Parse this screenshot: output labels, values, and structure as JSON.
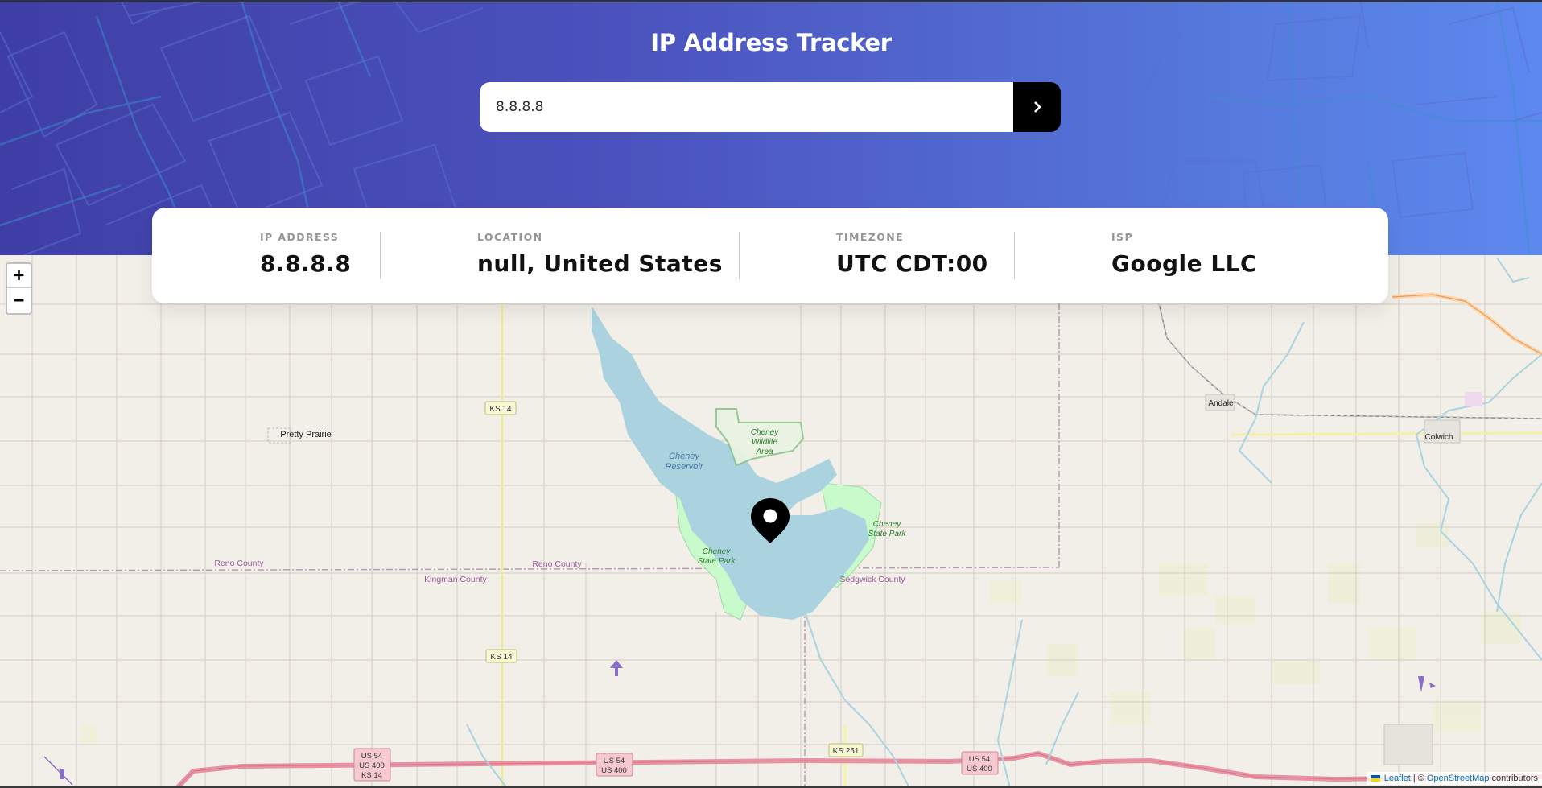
{
  "app": {
    "title": "IP Address Tracker"
  },
  "search": {
    "value": "8.8.8.8",
    "button_icon": "chevron-right-icon"
  },
  "info": {
    "ip": {
      "label": "IP ADDRESS",
      "value": "8.8.8.8"
    },
    "location": {
      "label": "LOCATION",
      "value": "null, United States"
    },
    "timezone": {
      "label": "TIMEZONE",
      "value": "UTC CDT:00"
    },
    "isp": {
      "label": "ISP",
      "value": "Google LLC"
    }
  },
  "map": {
    "zoom_in": "+",
    "zoom_out": "−",
    "marker_icon": "location-pin-icon",
    "labels": {
      "pretty_prairie": "Pretty Prairie",
      "cheney_wildlife": [
        "Cheney",
        "Wildlife",
        "Area"
      ],
      "cheney_reservoir": [
        "Cheney",
        "Reservoir"
      ],
      "cheney_sp_left": [
        "Cheney",
        "State Park"
      ],
      "cheney_sp_right": [
        "Cheney",
        "State Park"
      ],
      "reno_county_1": "Reno County",
      "reno_county_2": "Reno County",
      "kingman_county": "Kingman County",
      "sedgwick_county": "Sedgwick County",
      "andale": "Andale",
      "colwich": "Colwich",
      "ks14_a": "KS 14",
      "ks14_b": "KS 14",
      "ks251": "KS 251",
      "us54_a": [
        "US 54",
        "US 400",
        "KS 14"
      ],
      "us54_b": [
        "US 54",
        "US 400"
      ],
      "us54_c": [
        "US 54",
        "US 400"
      ]
    },
    "attribution": {
      "leaflet": "Leaflet",
      "separator": "| ©",
      "osm": "OpenStreetMap",
      "suffix": "contributors"
    }
  },
  "colors": {
    "header_start": "#3f3ea6",
    "header_end": "#5d88ef",
    "water": "#aad3df",
    "park": "#c8facc"
  }
}
